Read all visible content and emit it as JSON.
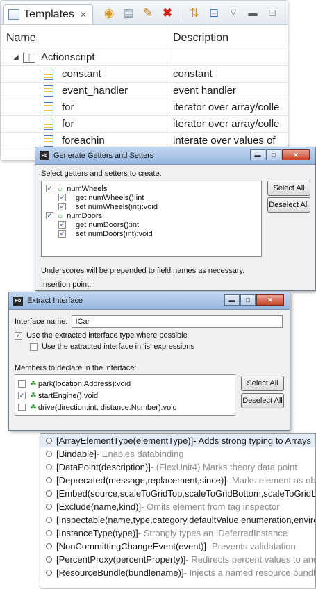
{
  "templates": {
    "tab_title": "Templates",
    "tab_close": "✕",
    "columns": {
      "name": "Name",
      "description": "Description"
    },
    "group": "Actionscript",
    "rows": [
      {
        "name": "constant",
        "description": "constant"
      },
      {
        "name": "event_handler",
        "description": "event handler"
      },
      {
        "name": "for",
        "description": "iterator over array/colle"
      },
      {
        "name": "for",
        "description": "iterator over array/colle"
      },
      {
        "name": "foreachin",
        "description": "interate over values of"
      }
    ],
    "toolbar_icons": [
      "new-template-icon",
      "copy-icon",
      "edit-pencil-icon",
      "delete-x-icon",
      "link-icon",
      "collapse-icon",
      "view-menu-icon",
      "minimize-icon",
      "maximize-icon"
    ]
  },
  "getters_setters": {
    "title": "Generate Getters and Setters",
    "prompt": "Select getters and setters to create:",
    "tree": [
      {
        "label": "numWheels",
        "level": 0,
        "checked": true
      },
      {
        "label": "get numWheels():int",
        "level": 1,
        "checked": true
      },
      {
        "label": "set numWheels(int):void",
        "level": 1,
        "checked": true
      },
      {
        "label": "numDoors",
        "level": 0,
        "checked": true
      },
      {
        "label": "get numDoors():int",
        "level": 1,
        "checked": true
      },
      {
        "label": "set numDoors(int):void",
        "level": 1,
        "checked": true
      }
    ],
    "select_all": "Select All",
    "deselect_all": "Deselect All",
    "note": "Underscores will be prepended to field names as necessary.",
    "insertion_point": "Insertion point:",
    "fb_badge": "Fb"
  },
  "extract_interface": {
    "title": "Extract Interface",
    "name_label": "Interface name:",
    "name_value": "ICar",
    "opt1": "Use the extracted interface type where possible",
    "opt1_checked": true,
    "opt2": "Use the extracted interface in 'is' expressions",
    "opt2_checked": false,
    "members_label": "Members to declare in the interface:",
    "members": [
      {
        "label": "park(location:Address):void",
        "checked": false
      },
      {
        "label": "startEngine():void",
        "checked": true
      },
      {
        "label": "drive(direction:int, distance:Number):void",
        "checked": false
      }
    ],
    "select_all": "Select All",
    "deselect_all": "Deselect All",
    "fb_badge": "Fb"
  },
  "metadata": [
    {
      "tag": "[ArrayElementType(elementType)]",
      "desc": " - Adds strong typing to Arrays",
      "selected": true
    },
    {
      "tag": "[Bindable]",
      "desc": " - Enables databinding",
      "selected": false
    },
    {
      "tag": "[DataPoint(description)]",
      "desc": " - (FlexUnit4) Marks theory data point",
      "selected": false
    },
    {
      "tag": "[Deprecated(message,replacement,since)]",
      "desc": " - Marks element as obsolete",
      "selected": false
    },
    {
      "tag": "[Embed(source,scaleToGridTop,scaleToGridBottom,scaleToGridLeft,",
      "desc": "",
      "selected": false
    },
    {
      "tag": "[Exclude(name,kind)]",
      "desc": " - Omits element from tag inspector",
      "selected": false
    },
    {
      "tag": "[Inspectable(name,type,category,defaultValue,enumeration,environment",
      "desc": "",
      "selected": false
    },
    {
      "tag": "[InstanceType(type)]",
      "desc": " - Strongly types an IDeferredInstance",
      "selected": false
    },
    {
      "tag": "[NonCommittingChangeEvent(event)]",
      "desc": " - Prevents validatation",
      "selected": false
    },
    {
      "tag": "[PercentProxy(percentProperty)]",
      "desc": " - Redirects percent values to another",
      "selected": false
    },
    {
      "tag": "[ResourceBundle(bundlename)]",
      "desc": " - Injects a named resource bundle",
      "selected": false
    }
  ]
}
